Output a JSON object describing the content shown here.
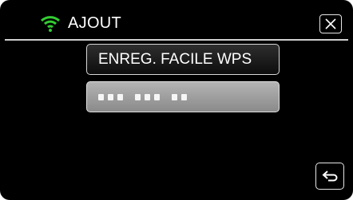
{
  "header": {
    "title": "AJOUT",
    "wifi_icon": "wifi-icon",
    "close_icon": "close-icon",
    "wifi_color": "#33cc33"
  },
  "menu": {
    "items": [
      {
        "label": "ENREG. FACILE WPS"
      },
      {
        "label": "",
        "masked_pin_groups": [
          3,
          3,
          2
        ]
      }
    ]
  },
  "footer": {
    "back_icon": "return-arrow-icon"
  }
}
